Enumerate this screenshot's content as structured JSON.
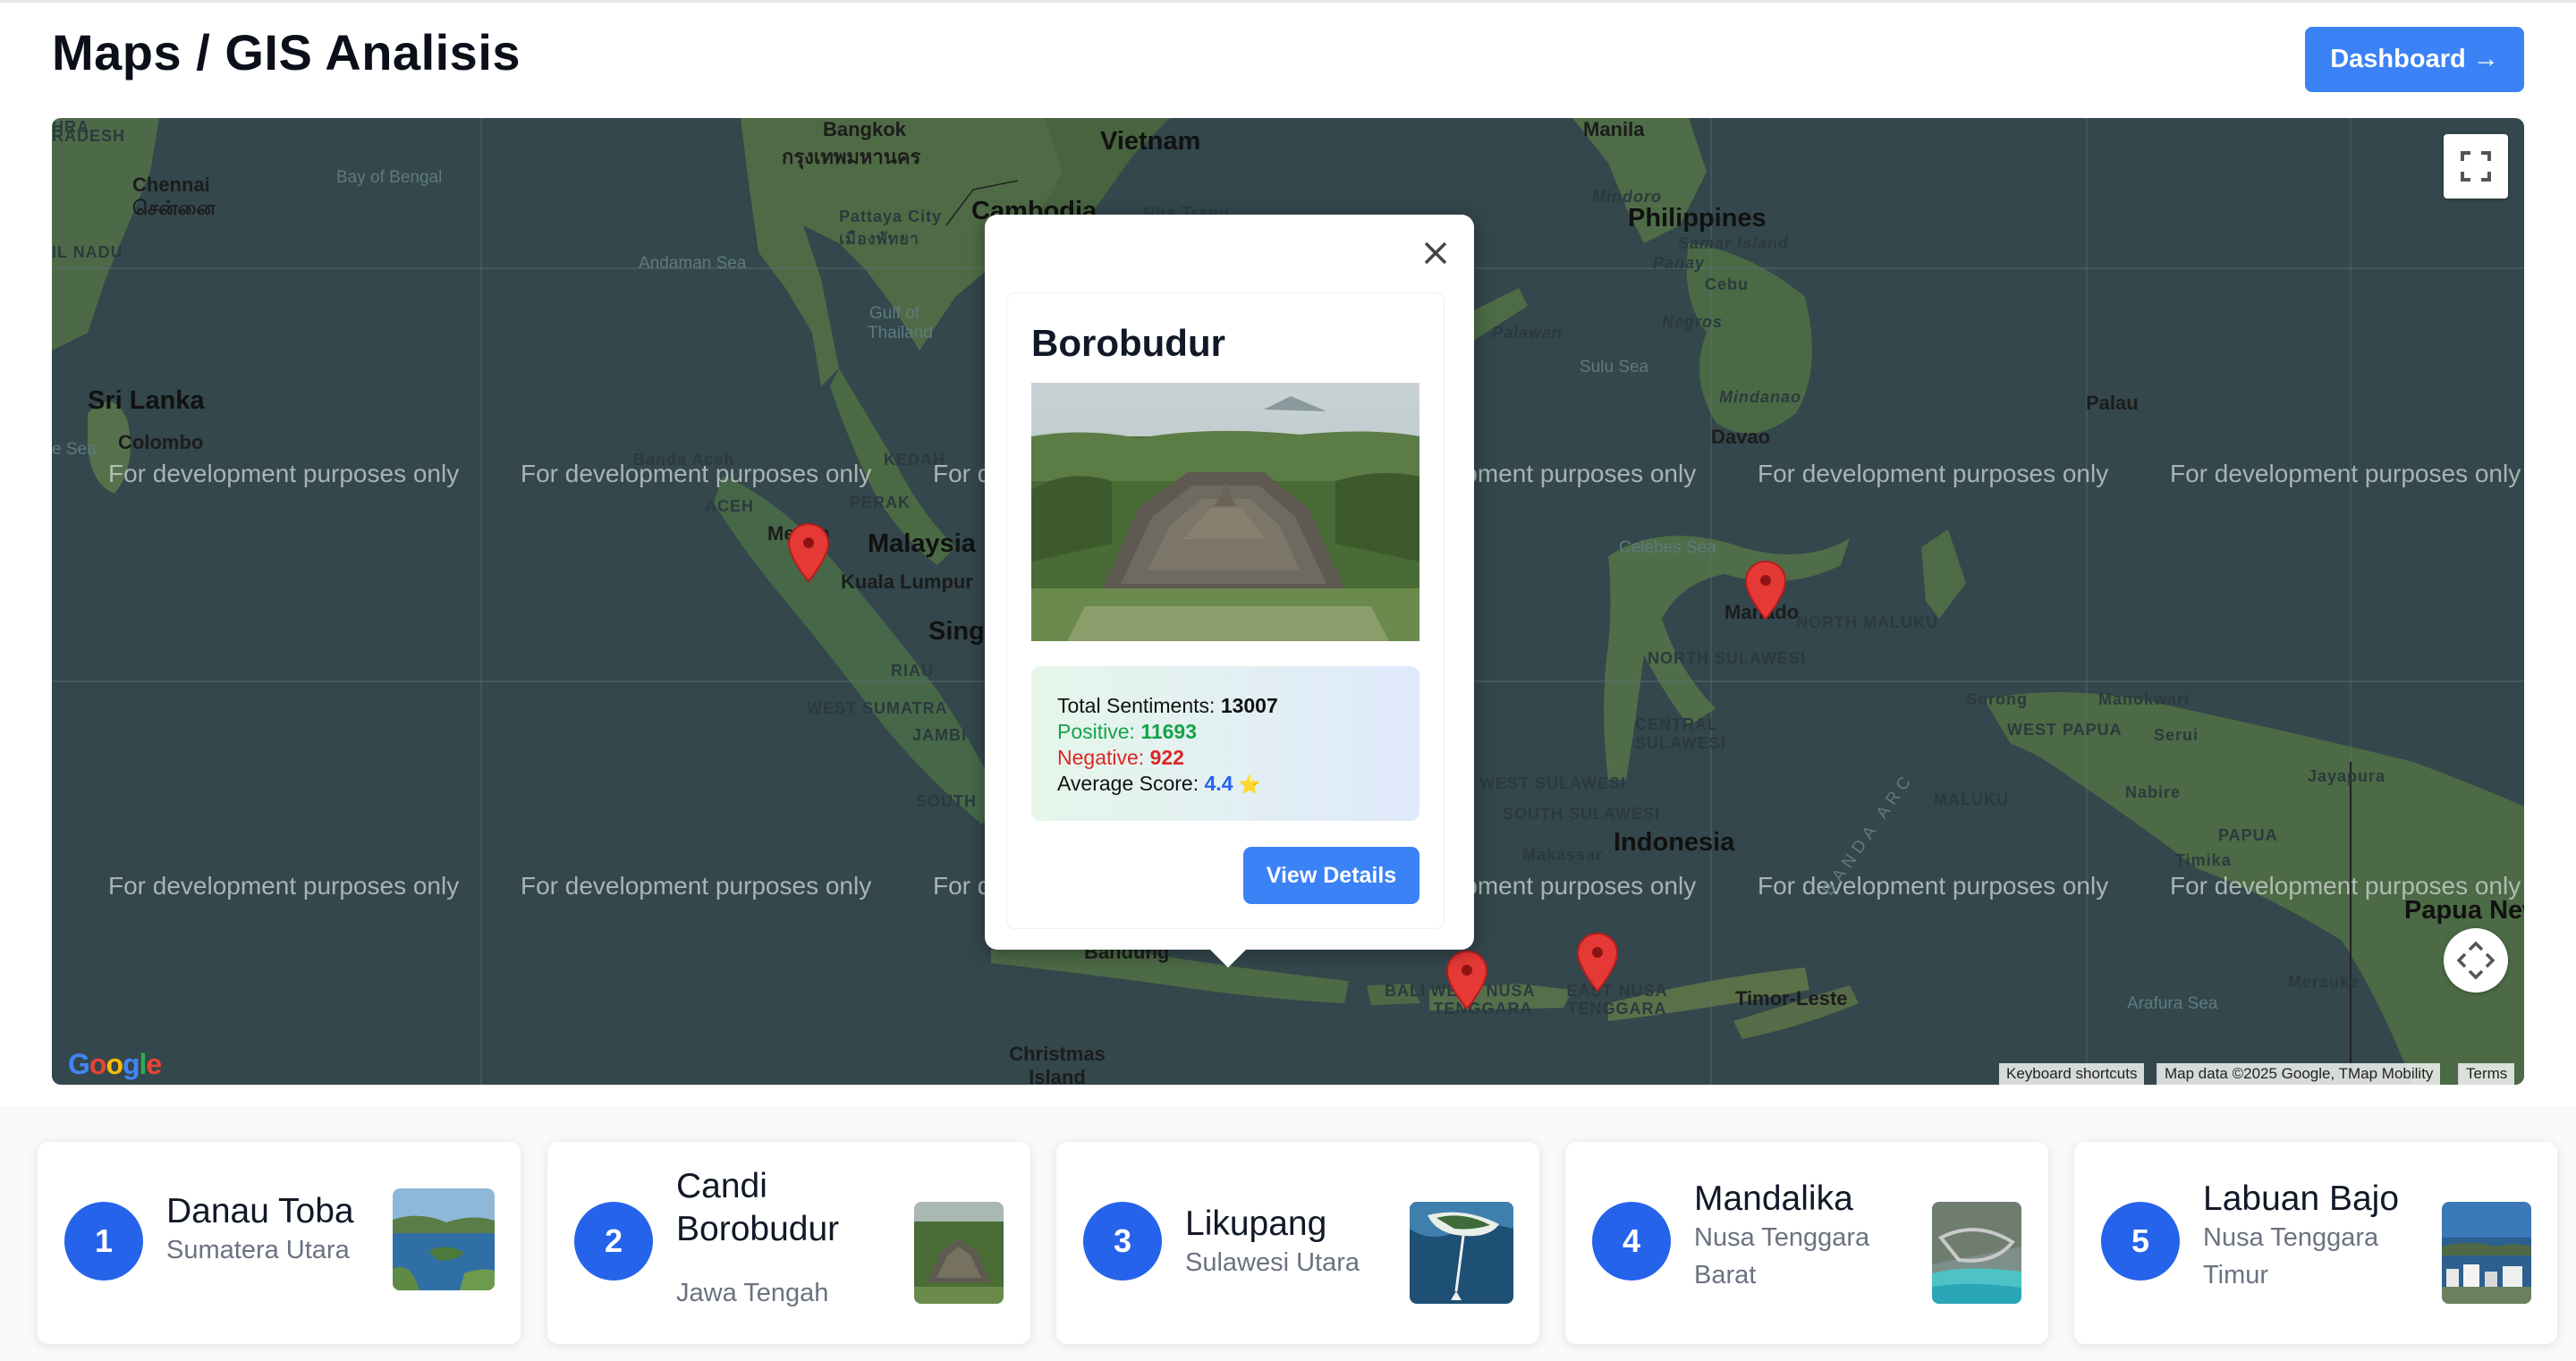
{
  "page": {
    "title": "Maps / GIS Analisis",
    "dashboard_label": "Dashboard →"
  },
  "map": {
    "watermark": "For development purposes only",
    "labels": {
      "bangkok": "Bangkok",
      "bangkok_th": "กรุงเทพมหานคร",
      "vietnam": "Vietnam",
      "manila": "Manila",
      "chennai": "Chennai",
      "chennai_ta": "சென்னை",
      "bay_of_bengal": "Bay of Bengal",
      "pattaya": "Pattaya City",
      "pattaya_th": "เมืองพัทยา",
      "cambodia": "Cambodia",
      "nha_trang": "Nha Trang",
      "philippines": "Philippines",
      "mindoro": "Mindoro",
      "samar_island": "Samar Island",
      "panay": "Panay",
      "cebu": "Cebu",
      "negros": "Negros",
      "andaman_sea": "Andaman Sea",
      "gulf_of_thailand": "Gulf of Thailand",
      "palawan": "Palawan",
      "sulu_sea": "Sulu Sea",
      "sri_lanka": "Sri Lanka",
      "colombo": "Colombo",
      "mindanao": "Mindanao",
      "davao": "Davao",
      "palau": "Palau",
      "banda_aceh": "Banda Aceh",
      "kedah": "KEDAH",
      "aceh": "ACEH",
      "perak": "PERAK",
      "medan": "Medan",
      "malaysia": "Malaysia",
      "kuala_lumpur": "Kuala Lumpur",
      "singapore": "Singa",
      "celebes_sea": "Celebes Sea",
      "manado": "Manado",
      "north_maluku": "NORTH MALUKU",
      "north_sulawesi": "NORTH SULAWESI",
      "riau": "RIAU",
      "west_sumatra": "WEST SUMATRA",
      "jambi": "JAMBI",
      "south": "SOUTH",
      "central_sulawesi": "CENTRAL SULAWESI",
      "sorong": "Sorong",
      "manokwari": "Manokwari",
      "west_papua": "WEST PAPUA",
      "serui": "Serui",
      "jayapura": "Jayapura",
      "west_sulawesi": "WEST SULAWESI",
      "south_sulawesi": "SOUTH SULAWESI",
      "banda_arc": "BANDA ARC",
      "maluku": "MALUKU",
      "nabire": "Nabire",
      "papua": "PAPUA",
      "timika": "Timika",
      "makassar": "Makassar",
      "indonesia": "Indonesia",
      "papua_new_guinea": "Papua New Gui",
      "bandung": "Bandung",
      "bali": "BALI",
      "west_nusa_tenggara": "WEST NUSA TENGGARA",
      "east_nusa_tenggara": "EAST NUSA TENGGARA",
      "timor_leste": "Timor-Leste",
      "arafura_sea": "Arafura Sea",
      "merauke": "Merauke",
      "christmas_island": "Christmas Island",
      "tamil_nadu": "IL NADU",
      "pradesh": "RADESH",
      "e_sea": "e Sea"
    },
    "attribution": {
      "keyboard": "Keyboard shortcuts",
      "mapdata": "Map data ©2025 Google, TMap Mobility",
      "terms": "Terms"
    }
  },
  "popup": {
    "title": "Borobudur",
    "total_label": "Total Sentiments:",
    "total_value": "13007",
    "positive_label": "Positive:",
    "positive_value": "11693",
    "negative_label": "Negative:",
    "negative_value": "922",
    "score_label": "Average Score:",
    "score_value": "4.4",
    "score_icon": "⭐",
    "button_label": "View Details"
  },
  "destinations": [
    {
      "rank": "1",
      "name": "Danau Toba",
      "region": "Sumatera Utara"
    },
    {
      "rank": "2",
      "name": "Candi Borobudur",
      "region": "Jawa Tengah"
    },
    {
      "rank": "3",
      "name": "Likupang",
      "region": "Sulawesi Utara"
    },
    {
      "rank": "4",
      "name": "Mandalika",
      "region": "Nusa Tenggara Barat"
    },
    {
      "rank": "5",
      "name": "Labuan Bajo",
      "region": "Nusa Tenggara Timur"
    }
  ],
  "colors": {
    "accent": "#3b82f6",
    "rank_badge": "#2563eb",
    "positive": "#16a34a",
    "negative": "#dc2626",
    "marker": "#e53935"
  }
}
